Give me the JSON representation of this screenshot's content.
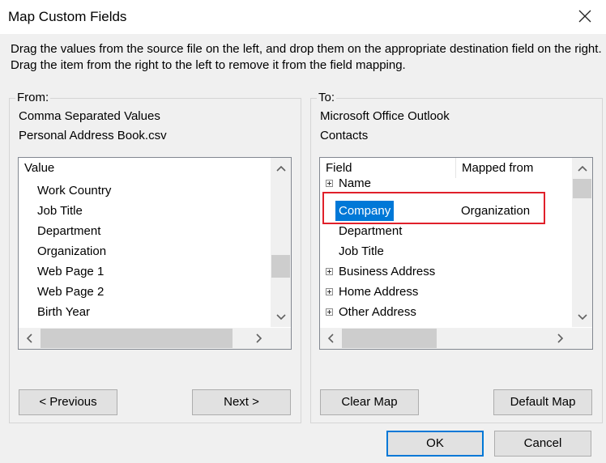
{
  "window": {
    "title": "Map Custom Fields",
    "close_icon": "close-icon"
  },
  "instructions": "Drag the values from the source file on the left, and drop them on the appropriate destination field on the right.  Drag the item from the right to the left to remove it from the field mapping.",
  "from": {
    "legend": "From:",
    "source_type": "Comma Separated Values",
    "source_file": "Personal Address Book.csv",
    "column_header": "Value",
    "items": [
      "Work Country",
      "Job Title",
      "Department",
      "Organization",
      "Web Page 1",
      "Web Page 2",
      "Birth Year"
    ]
  },
  "to": {
    "legend": "To:",
    "target_app": "Microsoft Office Outlook",
    "target_folder": "Contacts",
    "column_field": "Field",
    "column_mapped": "Mapped from",
    "rows": [
      {
        "field": "Name",
        "mapped": "",
        "expandable": true
      },
      {
        "field": "Company",
        "mapped": "Organization",
        "expandable": false,
        "selected": true
      },
      {
        "field": "Department",
        "mapped": "",
        "expandable": false
      },
      {
        "field": "Job Title",
        "mapped": "",
        "expandable": false
      },
      {
        "field": "Business Address",
        "mapped": "",
        "expandable": true
      },
      {
        "field": "Home Address",
        "mapped": "",
        "expandable": true
      },
      {
        "field": "Other Address",
        "mapped": "",
        "expandable": true
      }
    ]
  },
  "buttons": {
    "previous": "< Previous",
    "next": "Next >",
    "clear_map": "Clear Map",
    "default_map": "Default Map",
    "ok": "OK",
    "cancel": "Cancel"
  },
  "colors": {
    "selection": "#0078d7",
    "highlight_border": "#e0202a"
  }
}
